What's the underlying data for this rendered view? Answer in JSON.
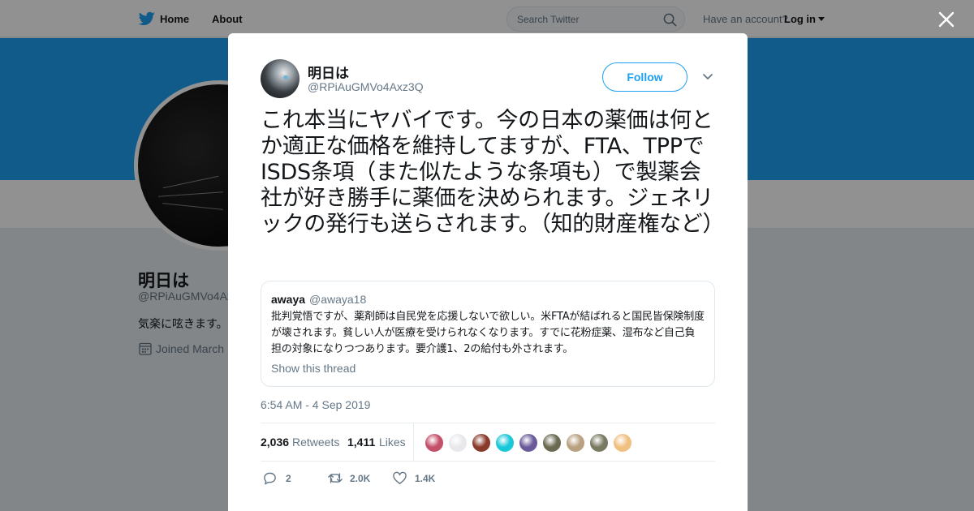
{
  "header": {
    "home_label": "Home",
    "about_label": "About",
    "search_placeholder": "Search Twitter",
    "have_account": "Have an account?",
    "login_label": "Log in"
  },
  "profile": {
    "name": "明日は",
    "handle": "@RPiAuGMVo4Axz3Q",
    "bio": "気楽に呟きます。",
    "joined": "Joined March"
  },
  "tweet": {
    "author_name": "明日は",
    "author_handle": "@RPiAuGMVo4Axz3Q",
    "follow_label": "Follow",
    "text": "これ本当にヤバイです。今の日本の薬価は何とか適正な価格を維持してますが、FTA、TPPでISDS条項（また似たような条項も）で製薬会社が好き勝手に薬価を決められます。ジェネリックの発行も送らされます。（知的財産権など）",
    "quoted": {
      "name": "awaya",
      "handle": "@awaya18",
      "text": "批判覚悟ですが、薬剤師は自民党を応援しないで欲しい。米FTAが結ばれると国民皆保険制度が壊されます。貧しい人が医療を受けられなくなります。すでに花粉症薬、湿布など自己負担の対象になりつつあります。要介護1、2の給付も外されます。",
      "show_thread": "Show this thread"
    },
    "timestamp": "6:54 AM - 4 Sep 2019",
    "retweets_count": "2,036",
    "retweets_label": "Retweets",
    "likes_count": "1,411",
    "likes_label": "Likes",
    "reply_count": "2",
    "retweet_count_short": "2.0K",
    "like_count_short": "1.4K"
  },
  "colors": {
    "accent": "#1da1f2",
    "liker_avatars": [
      "#c4506a",
      "#e8e8ec",
      "#8a3a2a",
      "#18c8d8",
      "#6a5a9a",
      "#6a6a52",
      "#b8a080",
      "#7a7a62",
      "#f0c080"
    ]
  }
}
